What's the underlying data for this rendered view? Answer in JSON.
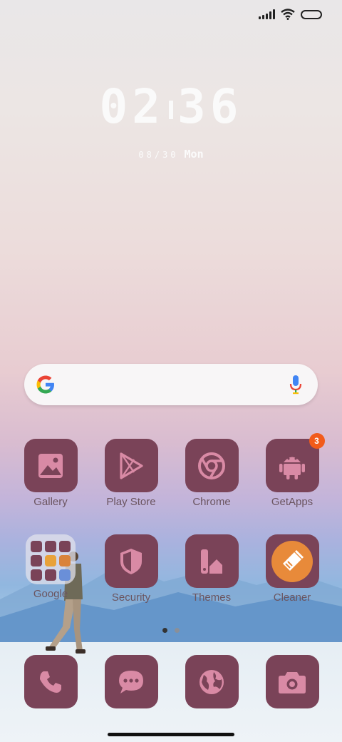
{
  "clock": {
    "hour": "02",
    "minute": "36"
  },
  "date": {
    "day": "08/30",
    "weekday": "Mon"
  },
  "search": {
    "google_icon": "google-g-icon",
    "mic_icon": "microphone-icon"
  },
  "apps_row1": [
    {
      "label": "Gallery",
      "icon": "gallery-icon"
    },
    {
      "label": "Play Store",
      "icon": "play-store-icon"
    },
    {
      "label": "Chrome",
      "icon": "chrome-icon"
    },
    {
      "label": "GetApps",
      "icon": "android-icon",
      "badge": "3"
    }
  ],
  "apps_row2": [
    {
      "label": "Google",
      "icon": "folder-icon"
    },
    {
      "label": "Security",
      "icon": "shield-icon"
    },
    {
      "label": "Themes",
      "icon": "themes-icon"
    },
    {
      "label": "Cleaner",
      "icon": "broom-icon"
    }
  ],
  "dock": [
    {
      "icon": "phone-icon"
    },
    {
      "icon": "messages-icon"
    },
    {
      "icon": "browser-globe-icon"
    },
    {
      "icon": "camera-icon"
    }
  ],
  "colors": {
    "tile": "#7a4358",
    "glyph": "#d98aa5",
    "badge": "#f25b1a",
    "cleaner": "#e88a3a"
  },
  "pager": {
    "pages": 2,
    "active": 1
  }
}
